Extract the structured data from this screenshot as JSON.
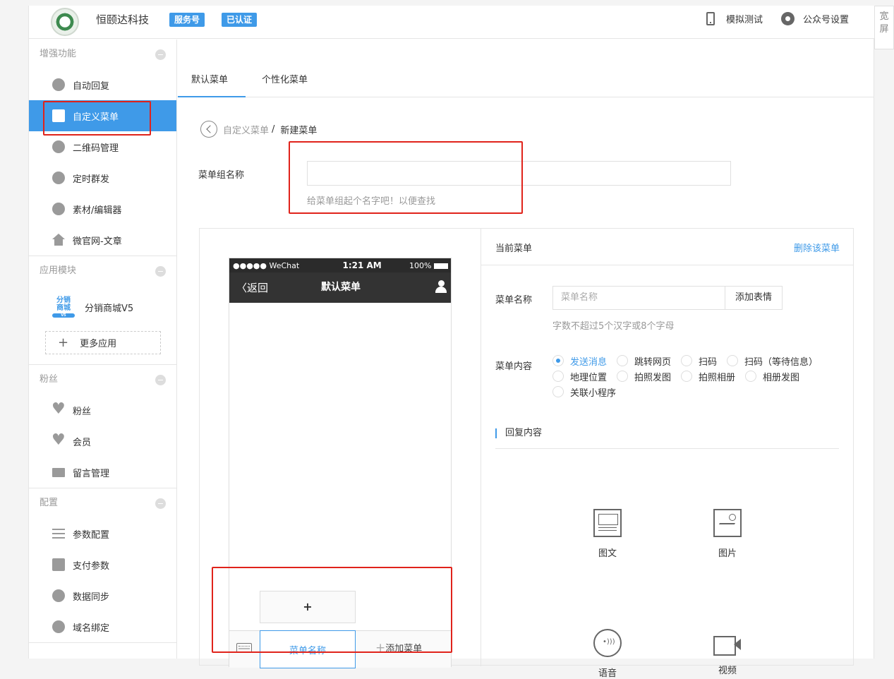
{
  "header": {
    "account_name": "恒颐达科技",
    "badges": [
      "服务号",
      "已认证"
    ],
    "simulate_label": "模拟测试",
    "settings_label": "公众号设置",
    "wide_screen_label": "宽屏"
  },
  "sidebar": {
    "sections": [
      {
        "title": "增强功能",
        "items": [
          "自动回复",
          "自定义菜单",
          "二维码管理",
          "定时群发",
          "素材/编辑器",
          "微官网-文章"
        ]
      },
      {
        "title": "应用模块",
        "app": {
          "icon_text": "分销商城",
          "icon_tag": "V5",
          "label": "分销商城V5"
        },
        "more_label": "更多应用"
      },
      {
        "title": "粉丝",
        "items": [
          "粉丝",
          "会员",
          "留言管理"
        ]
      },
      {
        "title": "配置",
        "items": [
          "参数配置",
          "支付参数",
          "数据同步",
          "域名绑定"
        ]
      }
    ],
    "active_item": "自定义菜单"
  },
  "tabs": [
    "默认菜单",
    "个性化菜单"
  ],
  "active_tab": "默认菜单",
  "breadcrumb": {
    "parent": "自定义菜单",
    "separator": "/",
    "current": "新建菜单"
  },
  "group_name": {
    "label": "菜单组名称",
    "value": "",
    "hint": "给菜单组起个名字吧！以便查找"
  },
  "phone": {
    "carrier": "●●●●● WeChat",
    "time": "1:21 AM",
    "battery": "100%",
    "back_label": "返回",
    "title": "默认菜单",
    "sub_add_label": "+",
    "menu_item_label": "菜单名称",
    "add_menu_label": "添加菜单"
  },
  "panel": {
    "title": "当前菜单",
    "delete_label": "删除该菜单",
    "menu_name_label": "菜单名称",
    "menu_name_placeholder": "菜单名称",
    "emoji_button": "添加表情",
    "menu_name_hint": "字数不超过5个汉字或8个字母",
    "content_label": "菜单内容",
    "options": [
      "发送消息",
      "跳转网页",
      "扫码",
      "扫码（等待信息）",
      "地理位置",
      "拍照发图",
      "拍照相册",
      "相册发图",
      "关联小程序"
    ],
    "selected_option": "发送消息",
    "reply_title": "回复内容",
    "reply_types": [
      "图文",
      "图片",
      "语音",
      "视频"
    ]
  }
}
